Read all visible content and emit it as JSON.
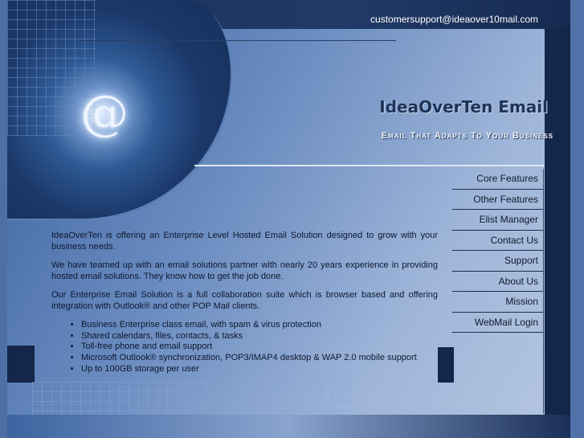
{
  "header": {
    "email": "customersupport@ideaover10mail.com",
    "brand": "IdeaOverTen Email",
    "tagline": "Email That Adapts To Your Business",
    "hero_symbol": "@"
  },
  "nav": {
    "items": [
      {
        "label": "Core Features"
      },
      {
        "label": "Other Features"
      },
      {
        "label": "Elist Manager"
      },
      {
        "label": "Contact Us"
      },
      {
        "label": "Support"
      },
      {
        "label": "About Us"
      },
      {
        "label": "Mission"
      },
      {
        "label": "WebMail Login"
      }
    ]
  },
  "content": {
    "paragraphs": [
      "IdeaOverTen is offering an Enterprise Level Hosted Email Solution designed to grow with your business needs.",
      "We have teamed up with an email solutions partner with nearly 20 years experience in providing hosted email solutions.  They know how to get the job done.",
      "Our Enterprise Email Solution is a full collaboration suite which is browser based and offering integration with Outlook® and other POP Mail clients."
    ],
    "bullets": [
      "Business Enterprise class email, with spam & virus protection",
      "Shared calendars, files, contacts, & tasks",
      "Toll-free phone and email support",
      "Microsoft Outlook® synchronization, POP3/IMAP4 desktop & WAP 2.0 mobile support",
      "Up to 100GB storage per user"
    ]
  }
}
